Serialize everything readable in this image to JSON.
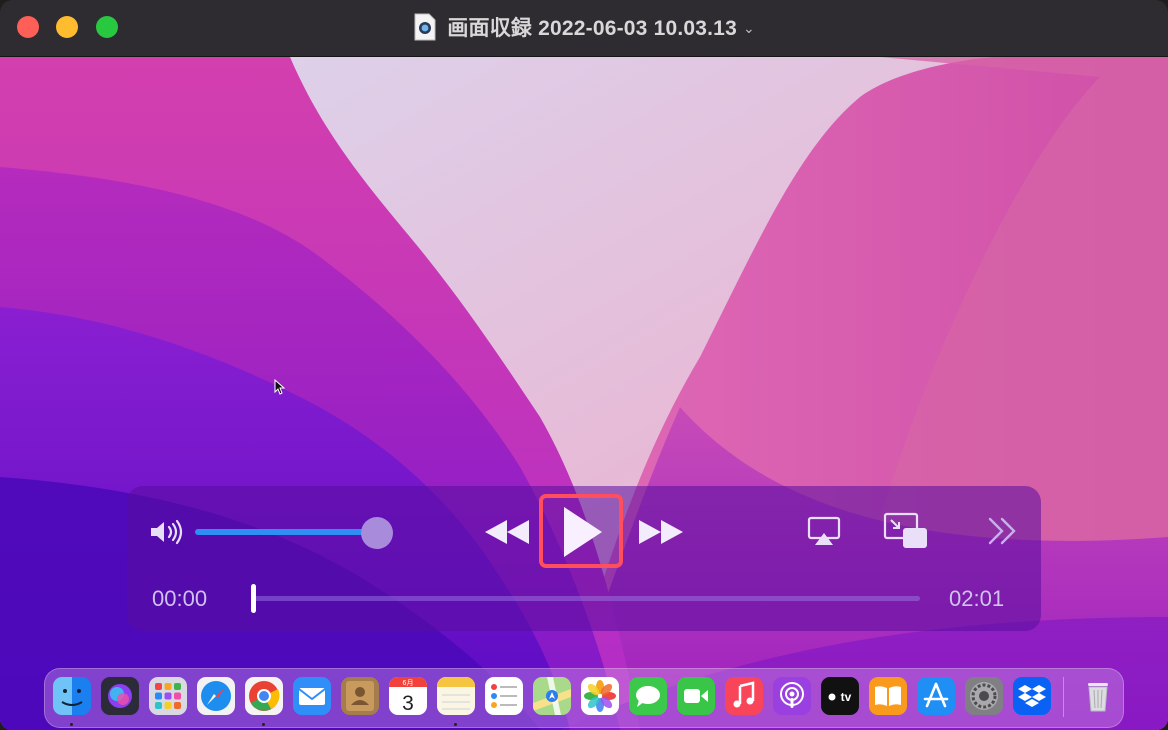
{
  "window": {
    "title": "画面収録 2022-06-03 10.03.13",
    "title_menu_icon": "chevron-down-icon",
    "document_icon": "quicktime-document-icon"
  },
  "player": {
    "current_time": "00:00",
    "total_time": "02:01",
    "volume_level": 0.9,
    "playback_progress": 0.0,
    "state": "paused",
    "play_button_highlight_color": "#ff4f5e"
  },
  "dock": {
    "apps": [
      {
        "name": "Finder",
        "icon": "finder-icon",
        "running": true
      },
      {
        "name": "Siri",
        "icon": "siri-icon",
        "running": false
      },
      {
        "name": "Launchpad",
        "icon": "launchpad-icon",
        "running": false
      },
      {
        "name": "Safari",
        "icon": "safari-icon",
        "running": false
      },
      {
        "name": "Google Chrome",
        "icon": "chrome-icon",
        "running": true
      },
      {
        "name": "Mail",
        "icon": "mail-icon",
        "running": false
      },
      {
        "name": "Contacts",
        "icon": "contacts-icon",
        "running": false
      },
      {
        "name": "Calendar",
        "icon": "calendar-icon",
        "running": false
      },
      {
        "name": "Notes",
        "icon": "notes-icon",
        "running": true
      },
      {
        "name": "Reminders",
        "icon": "reminders-icon",
        "running": false
      },
      {
        "name": "Maps",
        "icon": "maps-icon",
        "running": false
      },
      {
        "name": "Photos",
        "icon": "photos-icon",
        "running": false
      },
      {
        "name": "Messages",
        "icon": "messages-icon",
        "running": false
      },
      {
        "name": "FaceTime",
        "icon": "facetime-icon",
        "running": false
      },
      {
        "name": "Music",
        "icon": "music-icon",
        "running": false
      },
      {
        "name": "Podcasts",
        "icon": "podcasts-icon",
        "running": false
      },
      {
        "name": "TV",
        "icon": "tv-icon",
        "running": false
      },
      {
        "name": "Books",
        "icon": "books-icon",
        "running": false
      },
      {
        "name": "App Store",
        "icon": "app-store-icon",
        "running": false
      },
      {
        "name": "System Preferences",
        "icon": "system-preferences-icon",
        "running": false
      },
      {
        "name": "Dropbox",
        "icon": "dropbox-icon",
        "running": false
      }
    ],
    "calendar_month": "6月",
    "calendar_day": "3",
    "tv_label": "tv",
    "trash_icon": "trash-icon"
  }
}
